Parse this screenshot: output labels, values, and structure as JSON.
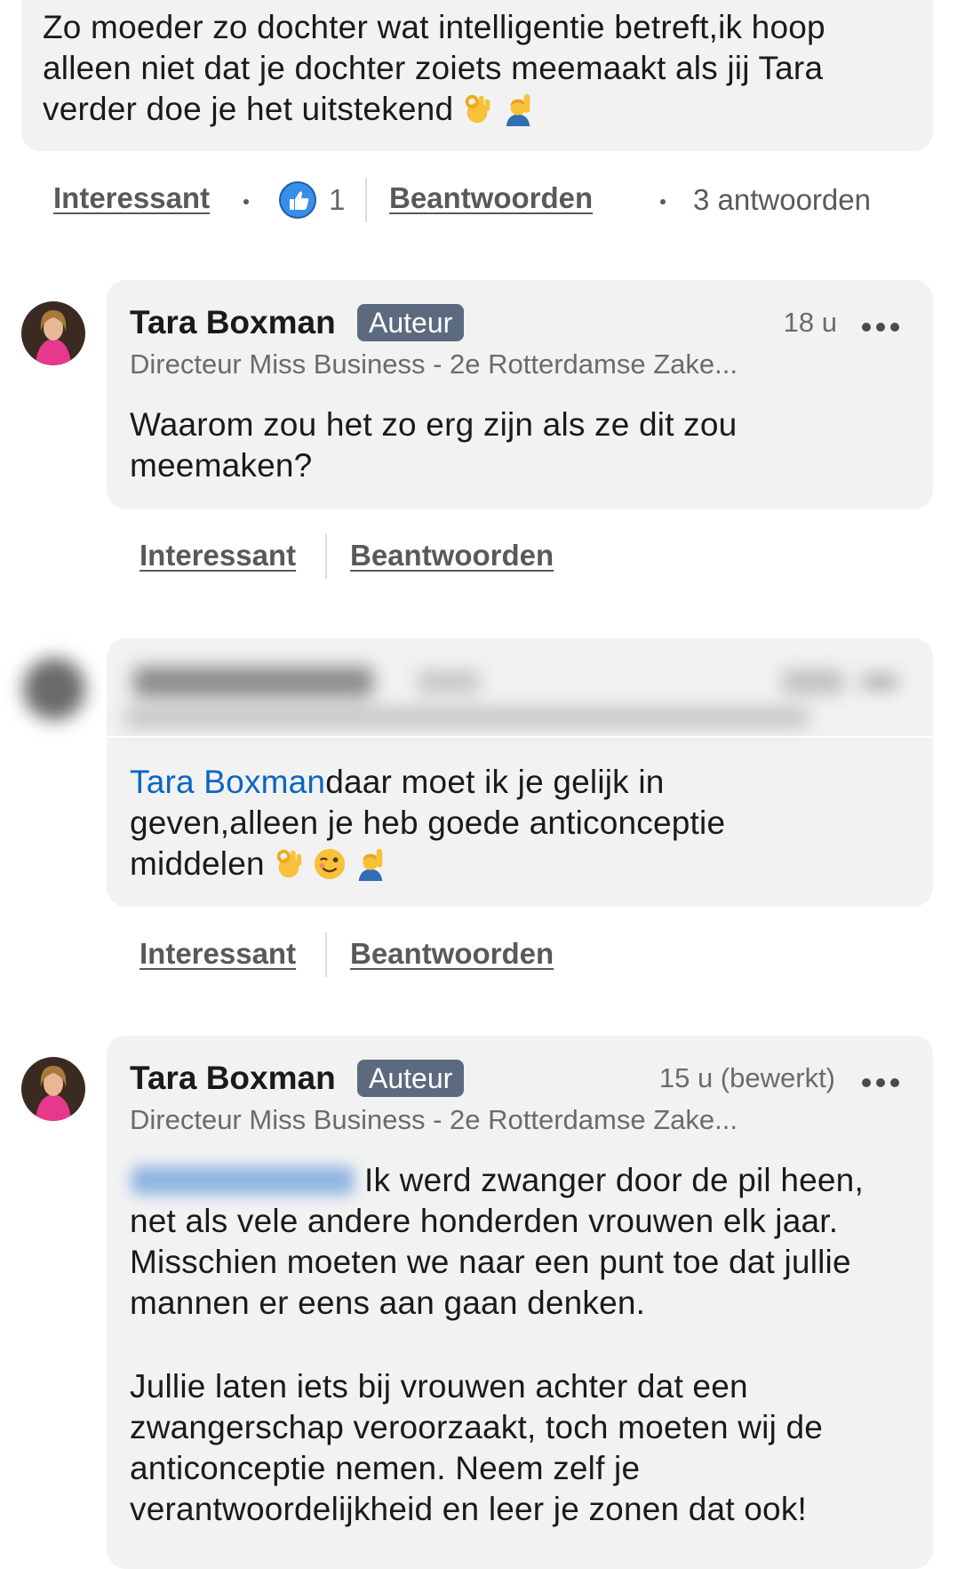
{
  "comment_top": {
    "text": "Zo moeder zo dochter wat intelligentie betreft,ik hoop alleen niet dat je dochter zoiets meemaakt als jij Tara verder doe je het uitstekend",
    "emojis": [
      "ok-hand-emoji",
      "raising-hand-emoji"
    ],
    "actions": {
      "like_label": "Interessant",
      "reaction_count": "1",
      "reply_label": "Beantwoorden",
      "replies_count": "3 antwoorden"
    }
  },
  "replies": [
    {
      "author": "Tara Boxman",
      "badge": "Auteur",
      "time": "18 u",
      "headline": "Directeur Miss Business - 2e Rotterdamse Zake...",
      "text": "Waarom zou het zo erg zijn als ze dit zou meemaken?",
      "like_label": "Interessant",
      "reply_label": "Beantwoorden"
    },
    {
      "author_blurred": true,
      "mention": "Tara Boxman",
      "text": "daar moet ik je gelijk in geven,alleen je heb goede anticonceptie middelen",
      "emojis": [
        "ok-hand-emoji",
        "winking-face-emoji",
        "raising-hand-emoji"
      ],
      "like_label": "Interessant",
      "reply_label": "Beantwoorden"
    },
    {
      "author": "Tara Boxman",
      "badge": "Auteur",
      "time": "15 u (bewerkt)",
      "headline": "Directeur Miss Business - 2e Rotterdamse Zake...",
      "text_p1": "Ik werd zwanger door de pil heen, net als vele andere honderden vrouwen elk jaar. Misschien moeten we naar een punt toe dat jullie mannen er eens aan gaan denken.",
      "text_p2": "Jullie laten iets bij vrouwen achter dat een zwangerschap veroorzaakt, toch moeten wij de anticonceptie nemen. Neem zelf je verantwoordelijkheid en leer je zonen dat ook!"
    }
  ],
  "colors": {
    "bubble": "#f2f2f2",
    "mention": "#0a66c2",
    "badge": "#5b6a7f",
    "reaction": "#378fe9"
  }
}
